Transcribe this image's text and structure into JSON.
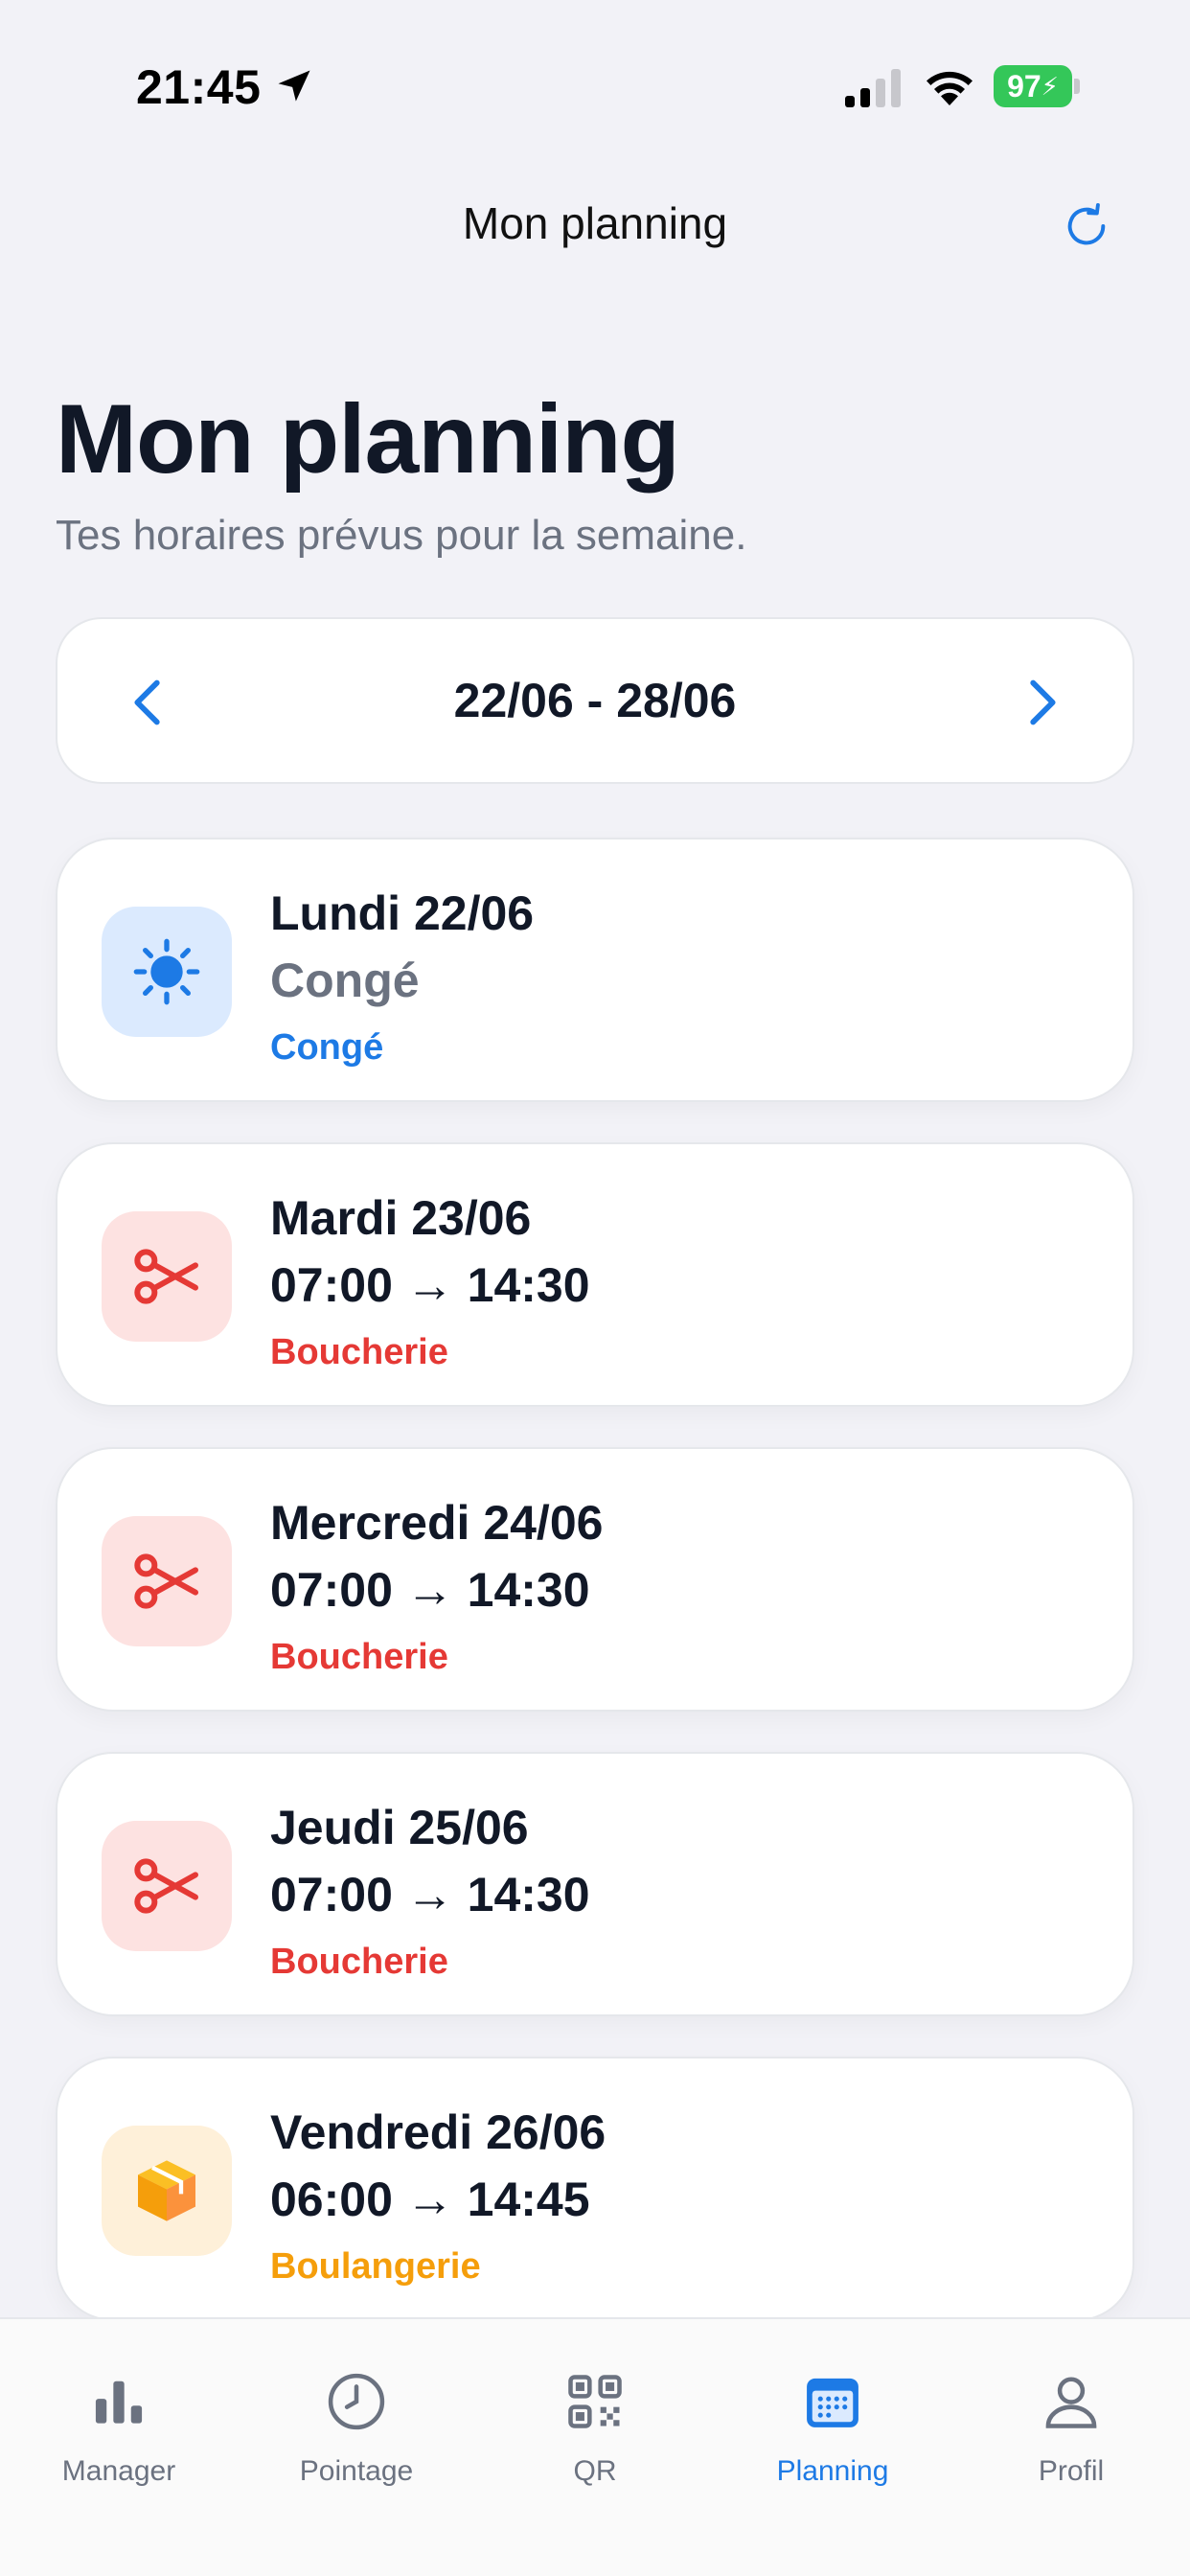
{
  "status_bar": {
    "time": "21:45",
    "battery": "97"
  },
  "nav": {
    "title": "Mon planning"
  },
  "header": {
    "title": "Mon planning",
    "subtitle": "Tes horaires prévus pour la semaine."
  },
  "week": {
    "range": "22/06 - 28/06"
  },
  "days": [
    {
      "name": "Lundi 22/06",
      "time": "Congé",
      "dept": "Congé",
      "icon": "sun-icon",
      "color": "#1d7ae5",
      "bg": "#dbeafe"
    },
    {
      "name": "Mardi 23/06",
      "time": "07:00 → 14:30",
      "dept": "Boucherie",
      "icon": "scissors-icon",
      "color": "#e53935",
      "bg": "#fde2e1"
    },
    {
      "name": "Mercredi 24/06",
      "time": "07:00 → 14:30",
      "dept": "Boucherie",
      "icon": "scissors-icon",
      "color": "#e53935",
      "bg": "#fde2e1"
    },
    {
      "name": "Jeudi 25/06",
      "time": "07:00 → 14:30",
      "dept": "Boucherie",
      "icon": "scissors-icon",
      "color": "#e53935",
      "bg": "#fde2e1"
    },
    {
      "name": "Vendredi 26/06",
      "time": "06:00 → 14:45",
      "dept": "Boulangerie",
      "icon": "package-icon",
      "color": "#f59e0b",
      "bg": "#fef0d9"
    }
  ],
  "tabs": [
    {
      "label": "Manager",
      "icon": "bar-chart-icon"
    },
    {
      "label": "Pointage",
      "icon": "clock-icon"
    },
    {
      "label": "QR",
      "icon": "qr-code-icon"
    },
    {
      "label": "Planning",
      "icon": "calendar-icon",
      "active": true
    },
    {
      "label": "Profil",
      "icon": "user-icon"
    }
  ],
  "colors": {
    "accent": "#1d7ae5",
    "boucherie": "#e53935",
    "boulangerie": "#f59e0b"
  }
}
